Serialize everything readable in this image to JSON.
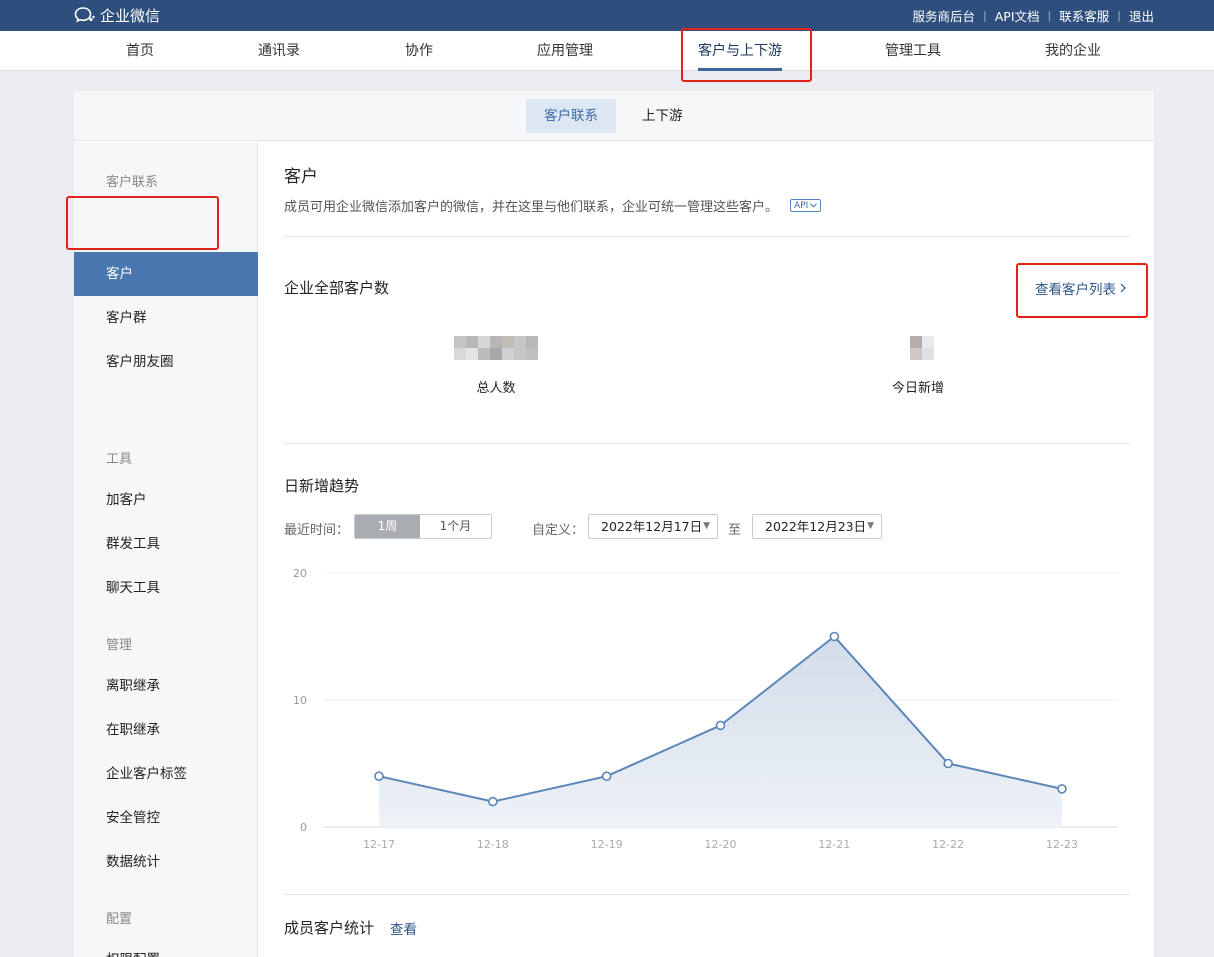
{
  "app": {
    "title": "企业微信"
  },
  "toplinks": [
    "服务商后台",
    "API文档",
    "联系客服",
    "退出"
  ],
  "mainnav": [
    "首页",
    "通讯录",
    "协作",
    "应用管理",
    "客户与上下游",
    "管理工具",
    "我的企业"
  ],
  "subtabs": [
    "客户联系",
    "上下游"
  ],
  "sidebar": {
    "groups": [
      {
        "heading": "客户联系",
        "items": [
          "客户",
          "客户群",
          "客户朋友圈"
        ]
      },
      {
        "heading": "工具",
        "items": [
          "加客户",
          "群发工具",
          "聊天工具"
        ]
      },
      {
        "heading": "管理",
        "items": [
          "离职继承",
          "在职继承",
          "企业客户标签",
          "安全管控",
          "数据统计"
        ]
      },
      {
        "heading": "配置",
        "items": [
          "权限配置"
        ]
      }
    ],
    "active": "客户"
  },
  "content": {
    "title": "客户",
    "description": "成员可用企业微信添加客户的微信，并在这里与他们联系，企业可统一管理这些客户。",
    "api_badge": "API",
    "total_section": {
      "title": "企业全部客户数",
      "view_list_link": "查看客户列表",
      "stats": [
        {
          "label": "总人数"
        },
        {
          "label": "今日新增"
        }
      ]
    },
    "trend": {
      "title": "日新增趋势",
      "recent_label": "最近时间：",
      "range_options": [
        "1周",
        "1个月"
      ],
      "selected_range": "1周",
      "custom_label": "自定义：",
      "start_date": "2022年12月17日",
      "to_label": "至",
      "end_date": "2022年12月23日"
    },
    "member_stats": {
      "title": "成员客户统计",
      "link": "查看"
    }
  },
  "chart_data": {
    "type": "area",
    "categories": [
      "12-17",
      "12-18",
      "12-19",
      "12-20",
      "12-21",
      "12-22",
      "12-23"
    ],
    "values": [
      4,
      2,
      4,
      8,
      15,
      5,
      3
    ],
    "ylim": [
      0,
      20
    ],
    "yticks": [
      0,
      10,
      20
    ],
    "grid": true,
    "colors": {
      "line": "#5b86ba",
      "fill": "#e8edf5"
    }
  },
  "colors": {
    "topbar": "#2e4f7d",
    "accent": "#4a76b0",
    "highlight": "#e2231a"
  }
}
